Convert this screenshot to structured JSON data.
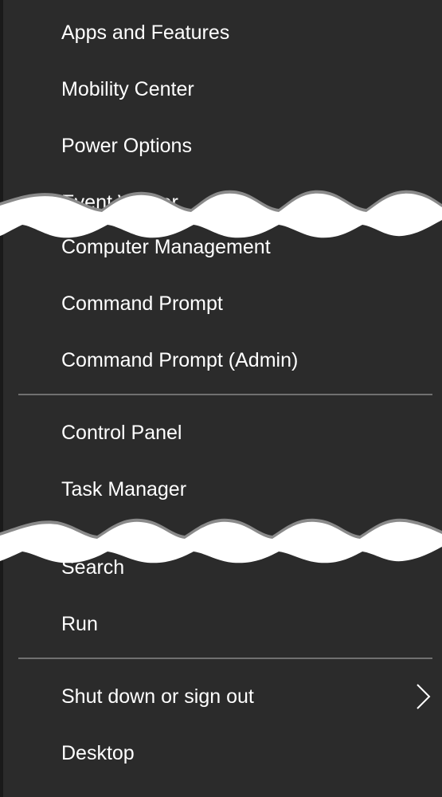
{
  "menu": {
    "items": [
      {
        "label": "Apps and Features"
      },
      {
        "label": "Mobility Center"
      },
      {
        "label": "Power Options"
      },
      {
        "label": "Event Viewer"
      },
      {
        "label": "Computer Management"
      },
      {
        "label": "Command Prompt"
      },
      {
        "label": "Command Prompt (Admin)"
      },
      {
        "label": "Control Panel"
      },
      {
        "label": "Task Manager"
      },
      {
        "label": "Search"
      },
      {
        "label": "Run"
      },
      {
        "label": "Shut down or sign out",
        "icon": "chevron-right-icon"
      },
      {
        "label": "Desktop"
      }
    ]
  },
  "colors": {
    "background": "#2b2b2b",
    "text": "#ffffff",
    "separator": "#707070"
  }
}
